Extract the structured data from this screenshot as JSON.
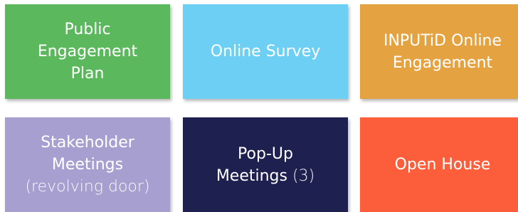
{
  "tiles": [
    {
      "lines": [
        "Public",
        "Engagement",
        "Plan"
      ],
      "color": "#5cb85c"
    },
    {
      "lines": [
        "Online Survey"
      ],
      "color": "#6ccff3"
    },
    {
      "lines": [
        "INPUTiD Online",
        "Engagement"
      ],
      "color": "#e5a241"
    },
    {
      "lines": [
        "Stakeholder",
        "Meetings",
        "(revolving door)"
      ],
      "color": "#a69fd0"
    },
    {
      "lines": [
        "Pop-Up",
        "Meetings",
        "(3)"
      ],
      "color": "#1e2150"
    },
    {
      "lines": [
        "Open House"
      ],
      "color": "#fc5d3a"
    }
  ]
}
